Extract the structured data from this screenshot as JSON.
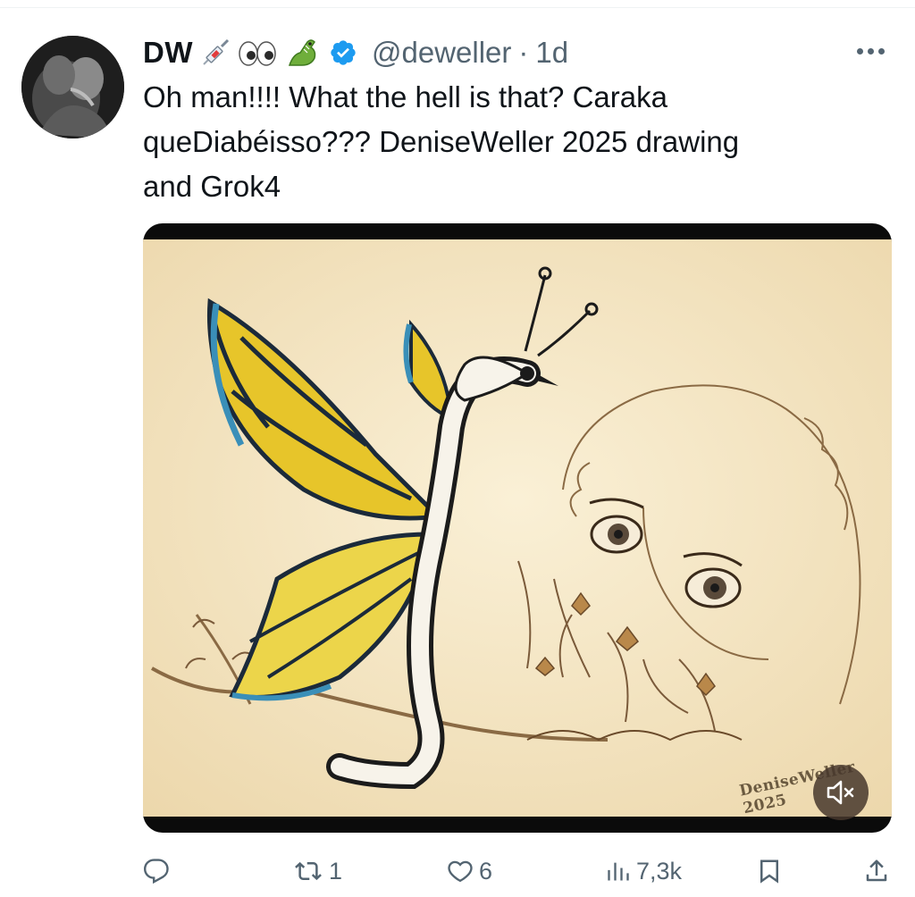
{
  "post": {
    "author_name": "DW",
    "handle": "@deweller",
    "separator": "·",
    "time": "1d",
    "text": "Oh man!!!! What the hell is that? Caraka\nqueDiabéisso??? DeniseWeller 2025 drawing\nand Grok4",
    "media": {
      "watermark": "DeniseWeller 2025",
      "description_icon": "artwork-image"
    }
  },
  "actions": {
    "reply_count": "",
    "repost_count": "1",
    "like_count": "6",
    "views_count": "7,3k"
  },
  "colors": {
    "text": "#0f1419",
    "muted": "#536471",
    "verified": "#1d9bf0",
    "paper": "#f5e6c6"
  }
}
